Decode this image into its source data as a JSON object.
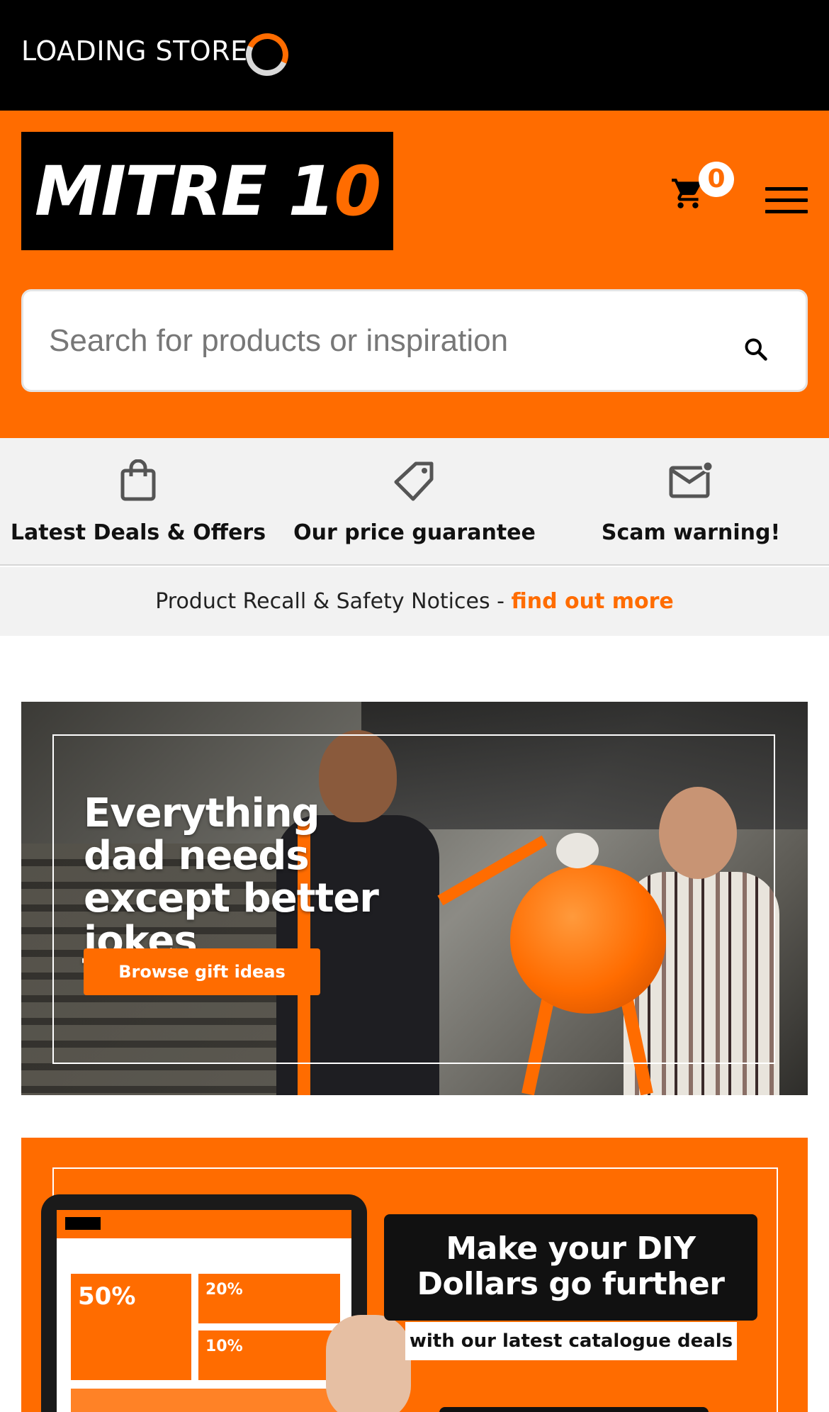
{
  "loading": {
    "text": "LOADING STORE"
  },
  "header": {
    "logo_text_main": "MITRE 1",
    "logo_text_accent": "0",
    "cart_count": "0",
    "accent_color": "#ff6c00"
  },
  "search": {
    "placeholder": "Search for products or inspiration"
  },
  "info_strip": {
    "items": [
      {
        "label": "Latest Deals & Offers",
        "icon": "shopping-bag-icon"
      },
      {
        "label": "Our price guarantee",
        "icon": "price-tag-icon"
      },
      {
        "label": "Scam warning!",
        "icon": "mail-alert-icon"
      }
    ]
  },
  "recall": {
    "text": "Product Recall & Safety Notices - ",
    "link": "find out more"
  },
  "hero1": {
    "title": "Everything dad needs except better jokes",
    "button": "Browse gift ideas"
  },
  "hero2": {
    "title": "Make your DIY Dollars go further",
    "subtitle": "with our latest catalogue deals",
    "tablet_tile1": "50%",
    "tablet_tile2": "20%",
    "tablet_tile3": "10%"
  }
}
